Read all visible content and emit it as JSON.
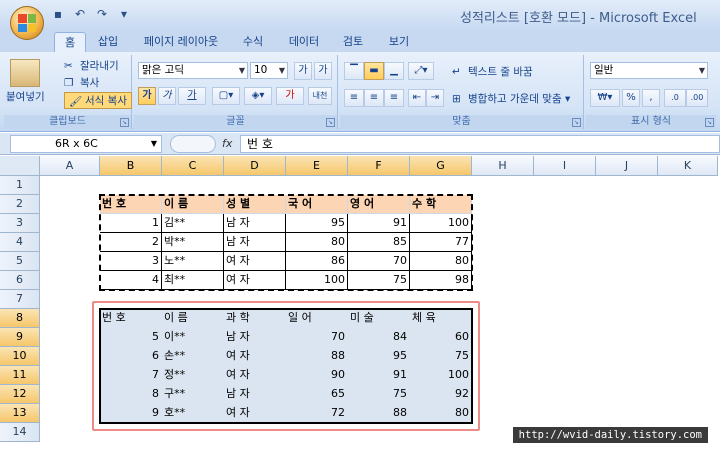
{
  "window": {
    "title": "성적리스트 [호환 모드] - Microsoft Excel"
  },
  "tabs": [
    "홈",
    "삽입",
    "페이지 레이아웃",
    "수식",
    "데이터",
    "검토",
    "보기"
  ],
  "ribbon": {
    "clipboard": {
      "paste": "붙여넣기",
      "cut": "잘라내기",
      "copy": "복사",
      "format_painter": "서식 복사",
      "label": "클립보드"
    },
    "font": {
      "font_name": "맑은 고딕",
      "font_size": "10",
      "grow": "가",
      "shrink": "가",
      "bold": "가",
      "italic": "가",
      "underline": "가",
      "color_text": "가",
      "phonetic": "내천",
      "label": "글꼴"
    },
    "align": {
      "wrap": "텍스트 줄 바꿈",
      "merge": "병합하고 가운데 맞춤",
      "label": "맞춤"
    },
    "number": {
      "format": "일반",
      "label": "표시 형식"
    }
  },
  "formula": {
    "name_box": "6R x 6C",
    "fx": "fx",
    "value": "번 호"
  },
  "columns": [
    "A",
    "B",
    "C",
    "D",
    "E",
    "F",
    "G",
    "H",
    "I",
    "J",
    "K"
  ],
  "rows": [
    "1",
    "2",
    "3",
    "4",
    "5",
    "6",
    "7",
    "8",
    "9",
    "10",
    "11",
    "12",
    "13",
    "14"
  ],
  "table1": {
    "header": [
      "번 호",
      "이 름",
      "성 별",
      "국 어",
      "영 어",
      "수 학"
    ],
    "rows": [
      [
        "1",
        "김**",
        "남 자",
        "95",
        "91",
        "100"
      ],
      [
        "2",
        "박**",
        "남 자",
        "80",
        "85",
        "77"
      ],
      [
        "3",
        "노**",
        "여 자",
        "86",
        "70",
        "80"
      ],
      [
        "4",
        "최**",
        "여 자",
        "100",
        "75",
        "98"
      ]
    ]
  },
  "table2": {
    "header": [
      "번 호",
      "이 름",
      "과 학",
      "일 어",
      "미 술",
      "체 육"
    ],
    "rows": [
      [
        "5",
        "이**",
        "남 자",
        "70",
        "84",
        "60"
      ],
      [
        "6",
        "손**",
        "여 자",
        "88",
        "95",
        "75"
      ],
      [
        "7",
        "정**",
        "여 자",
        "90",
        "91",
        "100"
      ],
      [
        "8",
        "구**",
        "남 자",
        "65",
        "75",
        "92"
      ],
      [
        "9",
        "호**",
        "여 자",
        "72",
        "88",
        "80"
      ]
    ]
  },
  "watermark": "http://wvid-daily.tistory.com"
}
